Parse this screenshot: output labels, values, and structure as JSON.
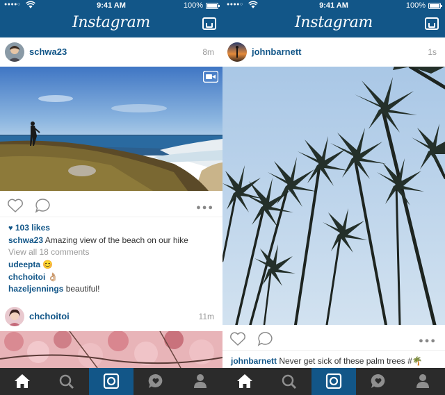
{
  "status_bar": {
    "time": "9:41 AM",
    "battery": "100%",
    "signal": "●●●●○"
  },
  "app": {
    "title": "Instagram"
  },
  "left": {
    "post1": {
      "user": "schwa23",
      "time": "8m",
      "likes": "103 likes",
      "caption_user": "schwa23",
      "caption_text": "Amazing view of the beach on our hike",
      "view_comments": "View all 18 comments",
      "comments": [
        {
          "user": "udeepta",
          "text": "😊"
        },
        {
          "user": "chchoitoi",
          "text": "👌🏼"
        },
        {
          "user": "hazeljennings",
          "text": "beautiful!"
        }
      ]
    },
    "post2": {
      "user": "chchoitoi",
      "time": "11m"
    }
  },
  "right": {
    "post": {
      "user": "johnbarnett",
      "time": "1s",
      "caption_user": "johnbarnett",
      "caption_text": "Never get sick of these palm trees #🌴"
    }
  },
  "tabs": [
    {
      "name": "home",
      "icon": "home-icon"
    },
    {
      "name": "explore",
      "icon": "search-icon"
    },
    {
      "name": "camera",
      "icon": "camera-icon"
    },
    {
      "name": "activity",
      "icon": "activity-heart-bubble-icon"
    },
    {
      "name": "profile",
      "icon": "profile-icon"
    }
  ],
  "colors": {
    "brand_blue": "#125688",
    "tab_bar": "#2b2b2b",
    "link": "#125688",
    "muted": "#9a9a9a"
  }
}
